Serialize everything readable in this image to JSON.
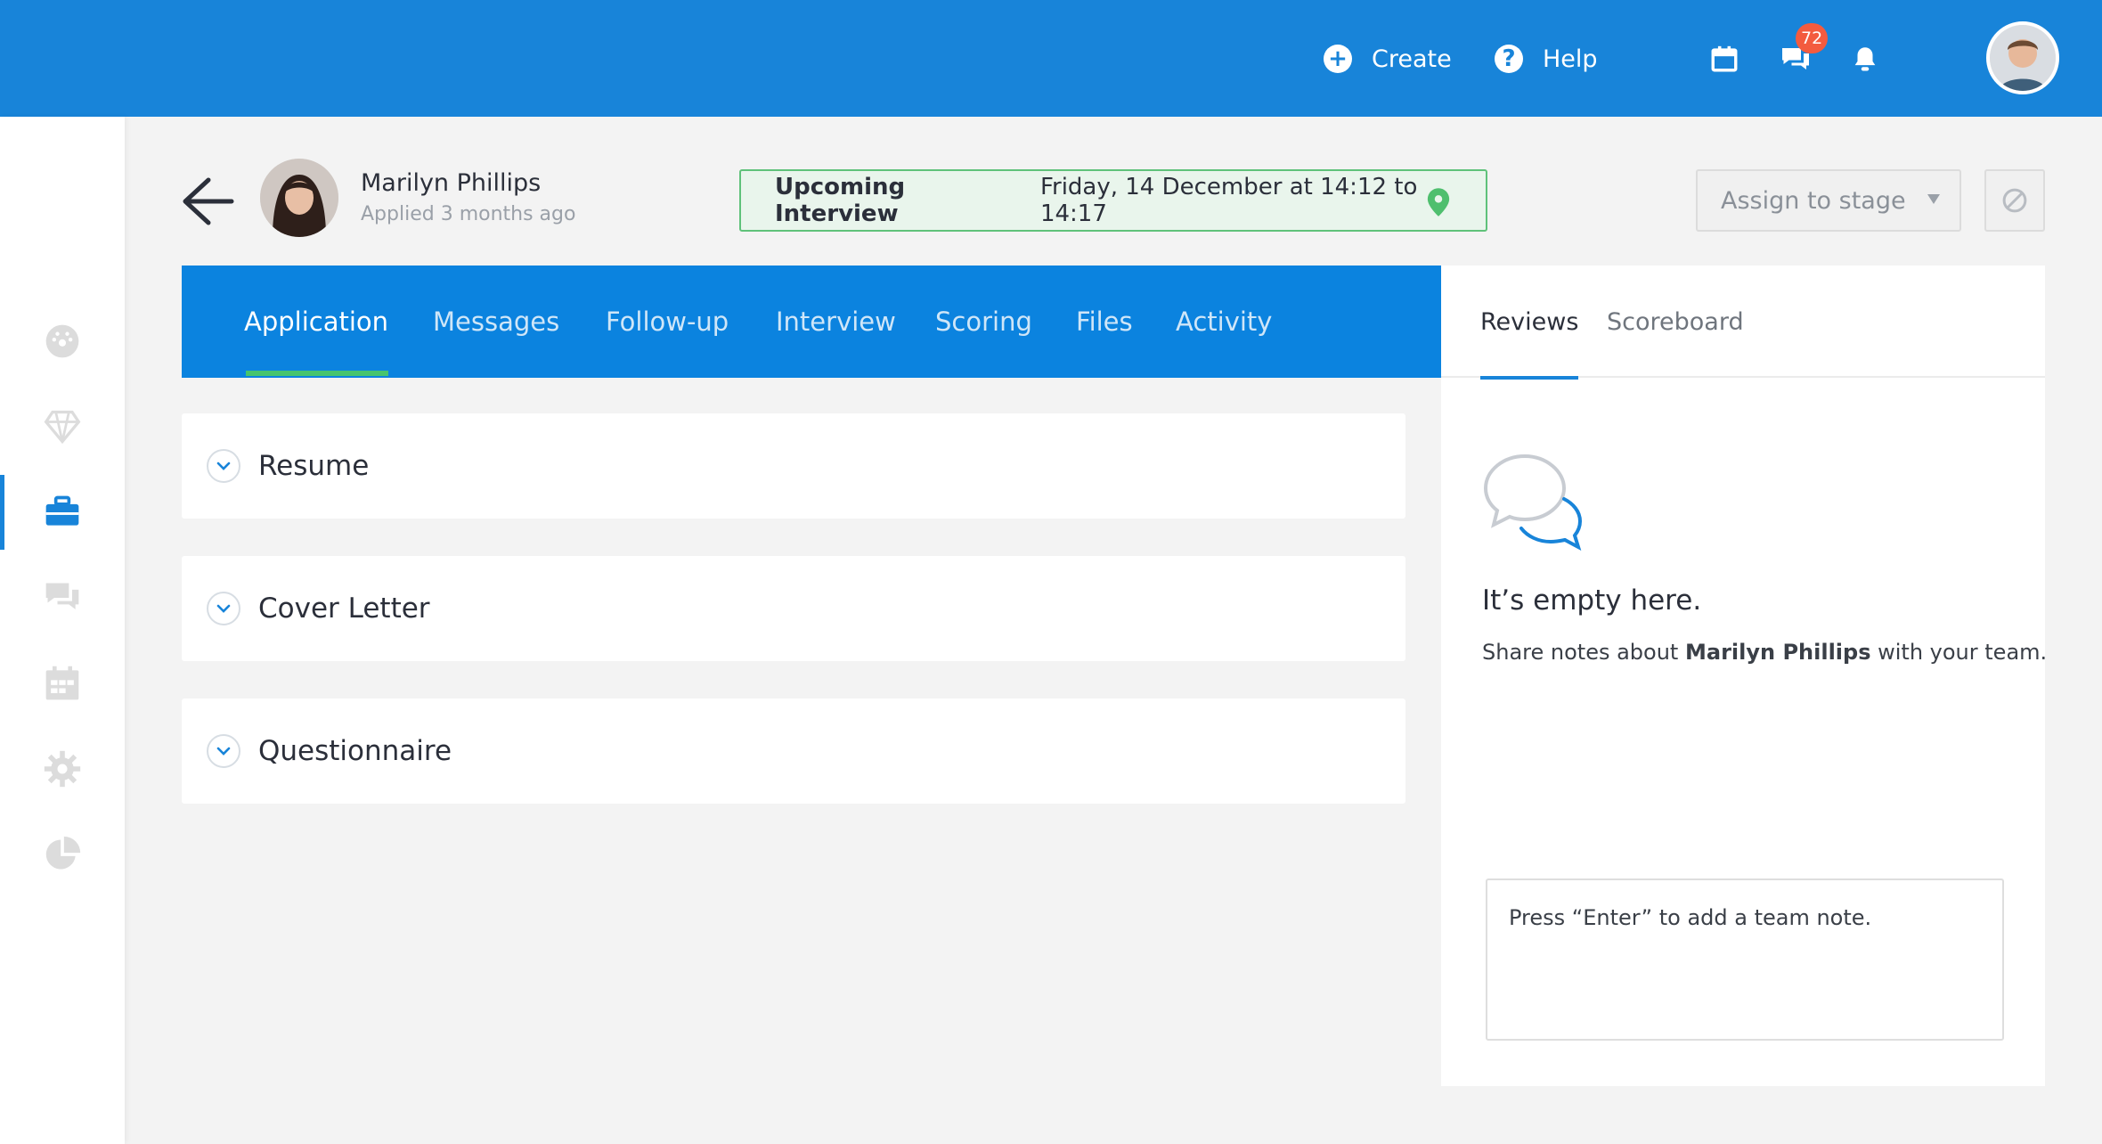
{
  "topbar": {
    "create_label": "Create",
    "help_label": "Help",
    "messages_badge": "72",
    "bg_color": "#1884d9"
  },
  "sidebar": {
    "items": [
      {
        "icon": "dashboard-icon"
      },
      {
        "icon": "diamond-icon"
      },
      {
        "icon": "briefcase-icon",
        "active": true
      },
      {
        "icon": "chat-icon"
      },
      {
        "icon": "calendar-icon"
      },
      {
        "icon": "gear-icon"
      },
      {
        "icon": "pie-chart-icon"
      }
    ]
  },
  "candidate": {
    "name": "Marilyn Phillips",
    "applied": "Applied 3 months ago"
  },
  "interview": {
    "label": "Upcoming Interview",
    "when": "Friday, 14 December at 14:12 to 14:17"
  },
  "actions": {
    "assign_label": "Assign to stage"
  },
  "tabs": [
    {
      "label": "Application",
      "active": true
    },
    {
      "label": "Messages"
    },
    {
      "label": "Follow-up"
    },
    {
      "label": "Interview"
    },
    {
      "label": "Scoring"
    },
    {
      "label": "Files"
    },
    {
      "label": "Activity"
    }
  ],
  "sections": [
    {
      "title": "Resume"
    },
    {
      "title": "Cover Letter"
    },
    {
      "title": "Questionnaire"
    }
  ],
  "right_panel": {
    "tabs": [
      {
        "label": "Reviews",
        "active": true
      },
      {
        "label": "Scoreboard"
      }
    ],
    "empty_title": "It’s empty here.",
    "empty_desc_prefix": "Share notes about",
    "empty_desc_name": "Marilyn Phillips",
    "empty_desc_suffix": "with your team.",
    "note_placeholder": "Press “Enter” to add a team note."
  }
}
